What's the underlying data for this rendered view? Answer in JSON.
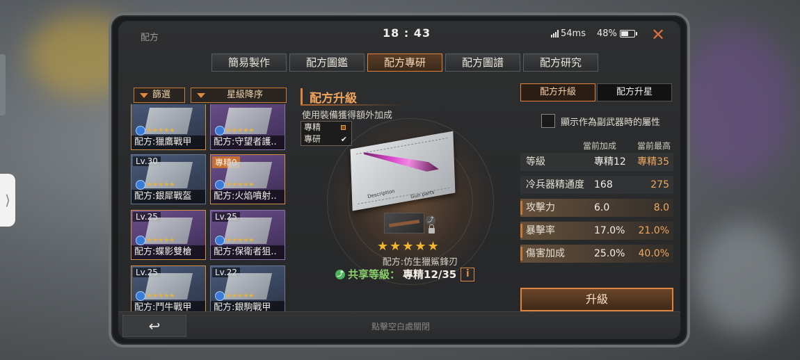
{
  "status_bar": {
    "title": "配方",
    "time": "18 : 43",
    "ping": "54ms",
    "battery": "48%"
  },
  "tabs": [
    {
      "label": "簡易製作"
    },
    {
      "label": "配方圖鑑"
    },
    {
      "label": "配方專研",
      "active": true
    },
    {
      "label": "配方圖譜"
    },
    {
      "label": "配方研究"
    }
  ],
  "filters": {
    "filter_label": "篩選",
    "sort_label": "星級降序"
  },
  "items": [
    {
      "level": "",
      "name": "配方:獵鷹戰甲",
      "stars": "★★★★★",
      "color": "blue"
    },
    {
      "level": "",
      "name": "配方:守望者護..",
      "stars": "★★★★★",
      "color": "purple"
    },
    {
      "level": "Lv.30",
      "name": "配方:銀犀戰盔",
      "stars": "★★★★★",
      "color": "blue"
    },
    {
      "level": "專精0",
      "name": "配方:火焰噴射..",
      "stars": "★★★★★",
      "color": "purple"
    },
    {
      "level": "Lv.25",
      "name": "配方:蝶影雙槍",
      "stars": "★★★★★",
      "color": "purple"
    },
    {
      "level": "Lv.25",
      "name": "配方:保衛者狙..",
      "stars": "★★★★★",
      "color": "purple"
    },
    {
      "level": "Lv.25",
      "name": "配方:鬥牛戰甲",
      "stars": "★★★★★",
      "color": "blue"
    },
    {
      "level": "Lv.22",
      "name": "配方:銀駒戰甲",
      "stars": "★★★★★",
      "color": "blue"
    }
  ],
  "middle": {
    "title": "配方升級",
    "subtitle": "使用裝備獲得額外加成",
    "check_options": [
      {
        "label": "專精",
        "checked": false
      },
      {
        "label": "專研",
        "checked": true
      }
    ],
    "blueprint_text_1": "Description",
    "blueprint_text_2": "Gun parts",
    "stars": "★★★★★",
    "recipe_name": "配方:仿生獵鯊鋒刃",
    "share_label": "共享等級：",
    "share_value": "專精12/35",
    "info_icon": "i"
  },
  "right": {
    "tabs": [
      {
        "label": "配方升級",
        "active": true
      },
      {
        "label": "配方升星"
      }
    ],
    "secondary_checkbox_label": "顯示作為副武器時的屬性",
    "col_current": "當前加成",
    "col_max": "當前最高",
    "stats": [
      {
        "label": "等級",
        "current": "專精12",
        "max": "專精35"
      },
      {
        "label": "冷兵器精通度",
        "current": "168",
        "max": "275"
      },
      {
        "label": "攻擊力",
        "current": "6.0",
        "max": "8.0"
      },
      {
        "label": "暴擊率",
        "current": "17.0%",
        "max": "21.0%"
      },
      {
        "label": "傷害加成",
        "current": "25.0%",
        "max": "40.0%"
      }
    ],
    "upgrade_button": "升級"
  },
  "bottom": {
    "back_icon": "↩",
    "hint": "點擊空白處關閉"
  },
  "colors": {
    "accent": "#e0833d",
    "star": "#f2b630",
    "share_green": "#8ad06a"
  }
}
